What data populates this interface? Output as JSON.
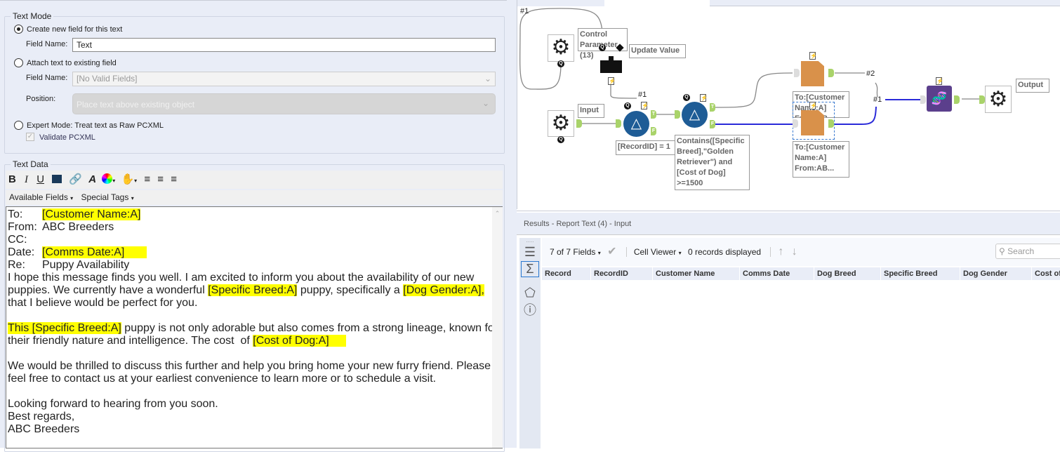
{
  "text_mode": {
    "title": "Text Mode",
    "option_create": "Create new field for this text",
    "field_name_label": "Field Name:",
    "field_name_value": "Text",
    "option_attach": "Attach text to existing field",
    "attach_field_label": "Field Name:",
    "attach_field_value": "[No Valid Fields]",
    "position_label": "Position:",
    "position_value": "Place text above existing object",
    "option_expert": "Expert Mode: Treat text as Raw PCXML",
    "validate_label": "Validate PCXML"
  },
  "text_data": {
    "title": "Text Data",
    "available_fields": "Available Fields",
    "special_tags": "Special Tags",
    "lines": [
      [
        "To:",
        "",
        "[Customer Name:A]",
        ""
      ],
      [
        "From:",
        "ABC Breeders",
        "",
        ""
      ],
      [
        "CC:",
        "",
        "",
        ""
      ],
      [
        "Date:",
        "",
        "[Comms Date:A]",
        ""
      ],
      [
        "Re:",
        "Puppy Availability",
        "",
        ""
      ]
    ],
    "para1_line1": "I hope this message finds you well. I am excited to inform you about the availability of our new",
    "para1_line2a": "puppies. We currently have a wonderful ",
    "para1_field1": "[Specific Breed:A]",
    "para1_line2b": " puppy, specifically a ",
    "para1_field2": "[Dog Gender:A]",
    "para1_line2c": ",",
    "para1_line3": "that I believe would be perfect for you.",
    "para2_a": "This ",
    "para2_field1": "[Specific Breed:A]",
    "para2_b": " puppy is not only adorable but also comes from a strong lineage, known for",
    "para2_line2a": "their friendly nature and intelligence. The cost  of ",
    "para2_field2": "[Cost of Dog:A]",
    "para3_line1": "We would be thrilled to discuss this further and help you bring home your new furry friend. Please",
    "para3_line2": "feel free to contact us at your earliest convenience to learn more or to schedule a visit.",
    "closing1": "Looking forward to hearing from you soon.",
    "closing2": "Best regards,",
    "closing3": "ABC Breeders"
  },
  "workflow": {
    "control_param_label": "Control Parameter (13)",
    "update_value_label": "Update Value",
    "input_label": "Input",
    "filter1_expr": "[RecordID] = 1",
    "filter2_expr": "Contains([Specific Breed],\"Golden Retriever\") and [Cost of Dog] >=1500",
    "report1_label": "To:[Customer Name:A] From:AB...",
    "report2_label": "To:[Customer Name:A] From:AB...",
    "output_label": "Output",
    "conn_1a": "#1",
    "conn_1b": "#1",
    "conn_1c": "#1",
    "conn_2": "#2",
    "anchor_t": "T",
    "anchor_f": "F",
    "q": "Q",
    "bolt": "⚡"
  },
  "results": {
    "title": "Results - Report Text (4) - Input",
    "fields_selector": "7 of 7 Fields",
    "cell_viewer": "Cell Viewer",
    "records_displayed": "0 records displayed",
    "search_placeholder": "Search",
    "columns": [
      "Record",
      "RecordID",
      "Customer Name",
      "Comms Date",
      "Dog Breed",
      "Specific Breed",
      "Dog Gender",
      "Cost of"
    ]
  },
  "colors": {
    "highlight": "#ffff00",
    "filter_blue": "#1e5c96",
    "report_orange": "#d9914a",
    "dna_purple": "#5b3f8c",
    "conn_blue": "#2b2bd9"
  }
}
